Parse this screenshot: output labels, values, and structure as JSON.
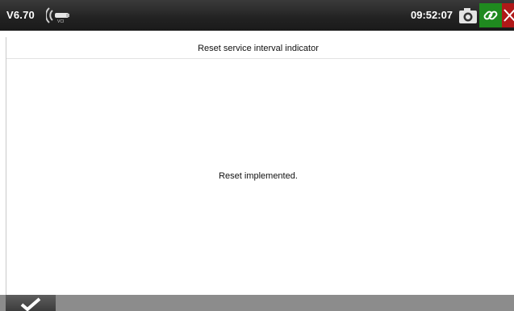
{
  "header": {
    "version": "V6.70",
    "time": "09:52:07",
    "icons": {
      "vci": "vci-connector-icon",
      "camera": "camera-icon",
      "link": "link-icon",
      "close": "close-icon"
    },
    "colors": {
      "link_button": "#1f8a1f",
      "close_button": "#b01818",
      "bar": "#222222"
    }
  },
  "main": {
    "title": "Reset service interval indicator",
    "message": "Reset implemented."
  },
  "footer": {
    "icons": {
      "ok": "checkmark-icon"
    }
  }
}
